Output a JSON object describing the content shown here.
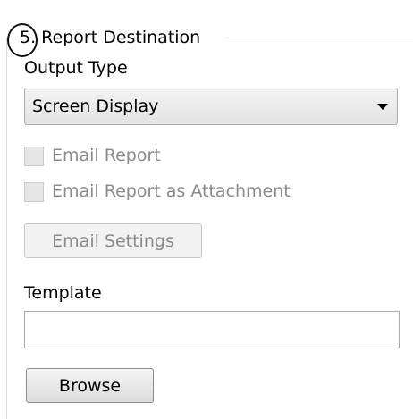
{
  "section": {
    "title": "5. Report Destination"
  },
  "output_type": {
    "label": "Output Type",
    "selected": "Screen Display"
  },
  "email_report": {
    "label": "Email Report",
    "checked": false,
    "enabled": false
  },
  "email_attachment": {
    "label": "Email Report as Attachment",
    "checked": false,
    "enabled": false
  },
  "email_settings_button": {
    "label": "Email Settings",
    "enabled": false
  },
  "template": {
    "label": "Template",
    "value": ""
  },
  "browse_button": {
    "label": "Browse"
  }
}
